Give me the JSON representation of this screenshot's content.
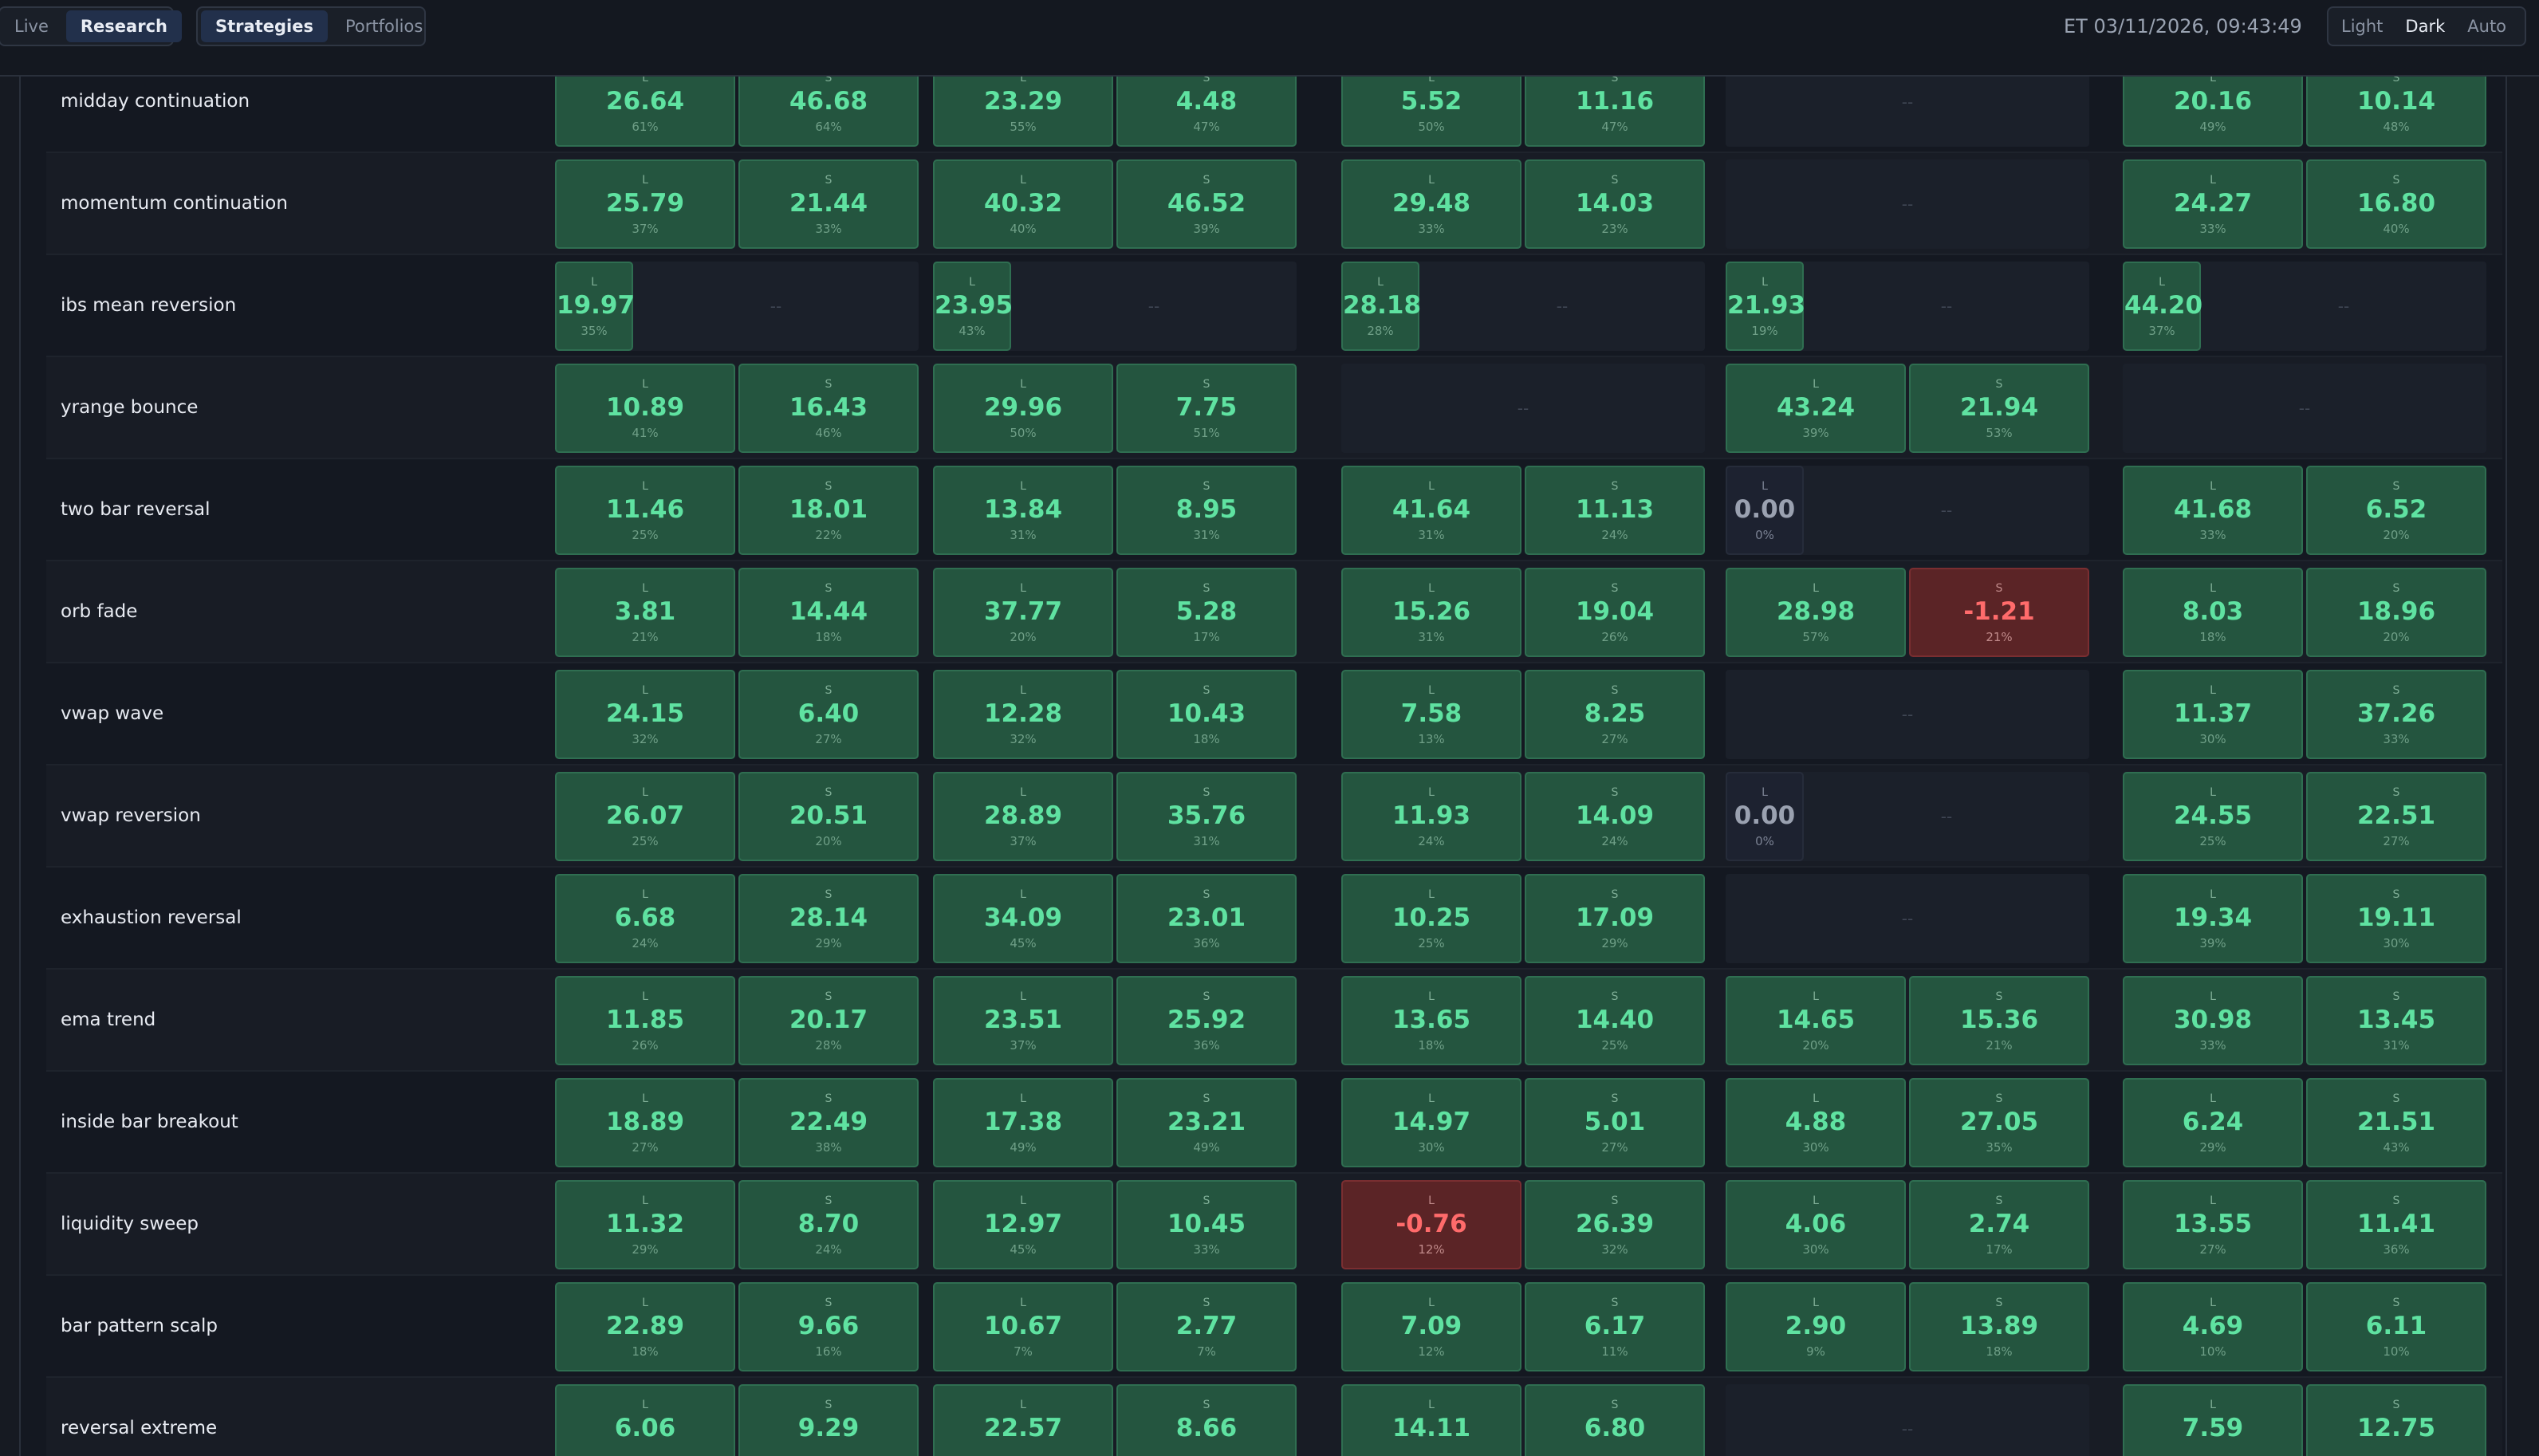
{
  "header": {
    "mode_tabs": [
      "Live",
      "Research"
    ],
    "mode_active": "Research",
    "view_tabs": [
      "Strategies",
      "Portfolios"
    ],
    "view_active": "Strategies",
    "clock": "ET 03/11/2026, 09:43:49",
    "theme_options": [
      "Light",
      "Dark",
      "Auto"
    ],
    "theme_active": "Dark"
  },
  "colors": {
    "positive_bg": "#24553f",
    "positive_text": "#5fe2a1",
    "negative_bg": "#5b2426",
    "negative_text": "#ff6b6b",
    "empty_bg": "#1b202a"
  },
  "empty_mark": "--",
  "rows": [
    {
      "name": "midday continuation",
      "groups": [
        {
          "cells": [
            {
              "side": "L",
              "value": "26.64",
              "pct": "61%"
            },
            {
              "side": "S",
              "value": "46.68",
              "pct": "64%"
            }
          ]
        },
        {
          "cells": [
            {
              "side": "L",
              "value": "23.29",
              "pct": "55%"
            },
            {
              "side": "S",
              "value": "4.48",
              "pct": "47%"
            }
          ]
        },
        {
          "cells": [
            {
              "side": "L",
              "value": "5.52",
              "pct": "50%"
            },
            {
              "side": "S",
              "value": "11.16",
              "pct": "47%"
            }
          ]
        },
        {
          "cells": []
        },
        {
          "cells": [
            {
              "side": "L",
              "value": "20.16",
              "pct": "49%"
            },
            {
              "side": "S",
              "value": "10.14",
              "pct": "48%"
            }
          ]
        }
      ]
    },
    {
      "name": "momentum continuation",
      "groups": [
        {
          "cells": [
            {
              "side": "L",
              "value": "25.79",
              "pct": "37%"
            },
            {
              "side": "S",
              "value": "21.44",
              "pct": "33%"
            }
          ]
        },
        {
          "cells": [
            {
              "side": "L",
              "value": "40.32",
              "pct": "40%"
            },
            {
              "side": "S",
              "value": "46.52",
              "pct": "39%"
            }
          ]
        },
        {
          "cells": [
            {
              "side": "L",
              "value": "29.48",
              "pct": "33%"
            },
            {
              "side": "S",
              "value": "14.03",
              "pct": "23%"
            }
          ]
        },
        {
          "cells": []
        },
        {
          "cells": [
            {
              "side": "L",
              "value": "24.27",
              "pct": "33%"
            },
            {
              "side": "S",
              "value": "16.80",
              "pct": "40%"
            }
          ]
        }
      ]
    },
    {
      "name": "ibs mean reversion",
      "groups": [
        {
          "cells": [
            {
              "side": "L",
              "value": "19.97",
              "pct": "35%",
              "narrow": true
            }
          ]
        },
        {
          "cells": [
            {
              "side": "L",
              "value": "23.95",
              "pct": "43%",
              "narrow": true
            }
          ]
        },
        {
          "cells": [
            {
              "side": "L",
              "value": "28.18",
              "pct": "28%",
              "narrow": true
            }
          ]
        },
        {
          "cells": [
            {
              "side": "L",
              "value": "21.93",
              "pct": "19%",
              "narrow": true
            }
          ]
        },
        {
          "cells": [
            {
              "side": "L",
              "value": "44.20",
              "pct": "37%",
              "narrow": true
            }
          ]
        }
      ]
    },
    {
      "name": "yrange bounce",
      "groups": [
        {
          "cells": [
            {
              "side": "L",
              "value": "10.89",
              "pct": "41%"
            },
            {
              "side": "S",
              "value": "16.43",
              "pct": "46%"
            }
          ]
        },
        {
          "cells": [
            {
              "side": "L",
              "value": "29.96",
              "pct": "50%"
            },
            {
              "side": "S",
              "value": "7.75",
              "pct": "51%"
            }
          ]
        },
        {
          "cells": []
        },
        {
          "cells": [
            {
              "side": "L",
              "value": "43.24",
              "pct": "39%"
            },
            {
              "side": "S",
              "value": "21.94",
              "pct": "53%"
            }
          ]
        },
        {
          "cells": []
        }
      ]
    },
    {
      "name": "two bar reversal",
      "groups": [
        {
          "cells": [
            {
              "side": "L",
              "value": "11.46",
              "pct": "25%"
            },
            {
              "side": "S",
              "value": "18.01",
              "pct": "22%"
            }
          ]
        },
        {
          "cells": [
            {
              "side": "L",
              "value": "13.84",
              "pct": "31%"
            },
            {
              "side": "S",
              "value": "8.95",
              "pct": "31%"
            }
          ]
        },
        {
          "cells": [
            {
              "side": "L",
              "value": "41.64",
              "pct": "31%"
            },
            {
              "side": "S",
              "value": "11.13",
              "pct": "24%"
            }
          ]
        },
        {
          "cells": [
            {
              "side": "L",
              "value": "0.00",
              "pct": "0%",
              "narrow": true
            }
          ]
        },
        {
          "cells": [
            {
              "side": "L",
              "value": "41.68",
              "pct": "33%"
            },
            {
              "side": "S",
              "value": "6.52",
              "pct": "20%"
            }
          ]
        }
      ]
    },
    {
      "name": "orb fade",
      "groups": [
        {
          "cells": [
            {
              "side": "L",
              "value": "3.81",
              "pct": "21%"
            },
            {
              "side": "S",
              "value": "14.44",
              "pct": "18%"
            }
          ]
        },
        {
          "cells": [
            {
              "side": "L",
              "value": "37.77",
              "pct": "20%"
            },
            {
              "side": "S",
              "value": "5.28",
              "pct": "17%"
            }
          ]
        },
        {
          "cells": [
            {
              "side": "L",
              "value": "15.26",
              "pct": "31%"
            },
            {
              "side": "S",
              "value": "19.04",
              "pct": "26%"
            }
          ]
        },
        {
          "cells": [
            {
              "side": "L",
              "value": "28.98",
              "pct": "57%"
            },
            {
              "side": "S",
              "value": "-1.21",
              "pct": "21%"
            }
          ]
        },
        {
          "cells": [
            {
              "side": "L",
              "value": "8.03",
              "pct": "18%"
            },
            {
              "side": "S",
              "value": "18.96",
              "pct": "20%"
            }
          ]
        }
      ]
    },
    {
      "name": "vwap wave",
      "groups": [
        {
          "cells": [
            {
              "side": "L",
              "value": "24.15",
              "pct": "32%"
            },
            {
              "side": "S",
              "value": "6.40",
              "pct": "27%"
            }
          ]
        },
        {
          "cells": [
            {
              "side": "L",
              "value": "12.28",
              "pct": "32%"
            },
            {
              "side": "S",
              "value": "10.43",
              "pct": "18%"
            }
          ]
        },
        {
          "cells": [
            {
              "side": "L",
              "value": "7.58",
              "pct": "13%"
            },
            {
              "side": "S",
              "value": "8.25",
              "pct": "27%"
            }
          ]
        },
        {
          "cells": []
        },
        {
          "cells": [
            {
              "side": "L",
              "value": "11.37",
              "pct": "30%"
            },
            {
              "side": "S",
              "value": "37.26",
              "pct": "33%"
            }
          ]
        }
      ]
    },
    {
      "name": "vwap reversion",
      "groups": [
        {
          "cells": [
            {
              "side": "L",
              "value": "26.07",
              "pct": "25%"
            },
            {
              "side": "S",
              "value": "20.51",
              "pct": "20%"
            }
          ]
        },
        {
          "cells": [
            {
              "side": "L",
              "value": "28.89",
              "pct": "37%"
            },
            {
              "side": "S",
              "value": "35.76",
              "pct": "31%"
            }
          ]
        },
        {
          "cells": [
            {
              "side": "L",
              "value": "11.93",
              "pct": "24%"
            },
            {
              "side": "S",
              "value": "14.09",
              "pct": "24%"
            }
          ]
        },
        {
          "cells": [
            {
              "side": "L",
              "value": "0.00",
              "pct": "0%",
              "narrow": true
            }
          ]
        },
        {
          "cells": [
            {
              "side": "L",
              "value": "24.55",
              "pct": "25%"
            },
            {
              "side": "S",
              "value": "22.51",
              "pct": "27%"
            }
          ]
        }
      ]
    },
    {
      "name": "exhaustion reversal",
      "groups": [
        {
          "cells": [
            {
              "side": "L",
              "value": "6.68",
              "pct": "24%"
            },
            {
              "side": "S",
              "value": "28.14",
              "pct": "29%"
            }
          ]
        },
        {
          "cells": [
            {
              "side": "L",
              "value": "34.09",
              "pct": "45%"
            },
            {
              "side": "S",
              "value": "23.01",
              "pct": "36%"
            }
          ]
        },
        {
          "cells": [
            {
              "side": "L",
              "value": "10.25",
              "pct": "25%"
            },
            {
              "side": "S",
              "value": "17.09",
              "pct": "29%"
            }
          ]
        },
        {
          "cells": []
        },
        {
          "cells": [
            {
              "side": "L",
              "value": "19.34",
              "pct": "39%"
            },
            {
              "side": "S",
              "value": "19.11",
              "pct": "30%"
            }
          ]
        }
      ]
    },
    {
      "name": "ema trend",
      "groups": [
        {
          "cells": [
            {
              "side": "L",
              "value": "11.85",
              "pct": "26%"
            },
            {
              "side": "S",
              "value": "20.17",
              "pct": "28%"
            }
          ]
        },
        {
          "cells": [
            {
              "side": "L",
              "value": "23.51",
              "pct": "37%"
            },
            {
              "side": "S",
              "value": "25.92",
              "pct": "36%"
            }
          ]
        },
        {
          "cells": [
            {
              "side": "L",
              "value": "13.65",
              "pct": "18%"
            },
            {
              "side": "S",
              "value": "14.40",
              "pct": "25%"
            }
          ]
        },
        {
          "cells": [
            {
              "side": "L",
              "value": "14.65",
              "pct": "20%"
            },
            {
              "side": "S",
              "value": "15.36",
              "pct": "21%"
            }
          ]
        },
        {
          "cells": [
            {
              "side": "L",
              "value": "30.98",
              "pct": "33%"
            },
            {
              "side": "S",
              "value": "13.45",
              "pct": "31%"
            }
          ]
        }
      ]
    },
    {
      "name": "inside bar breakout",
      "groups": [
        {
          "cells": [
            {
              "side": "L",
              "value": "18.89",
              "pct": "27%"
            },
            {
              "side": "S",
              "value": "22.49",
              "pct": "38%"
            }
          ]
        },
        {
          "cells": [
            {
              "side": "L",
              "value": "17.38",
              "pct": "49%"
            },
            {
              "side": "S",
              "value": "23.21",
              "pct": "49%"
            }
          ]
        },
        {
          "cells": [
            {
              "side": "L",
              "value": "14.97",
              "pct": "30%"
            },
            {
              "side": "S",
              "value": "5.01",
              "pct": "27%"
            }
          ]
        },
        {
          "cells": [
            {
              "side": "L",
              "value": "4.88",
              "pct": "30%"
            },
            {
              "side": "S",
              "value": "27.05",
              "pct": "35%"
            }
          ]
        },
        {
          "cells": [
            {
              "side": "L",
              "value": "6.24",
              "pct": "29%"
            },
            {
              "side": "S",
              "value": "21.51",
              "pct": "43%"
            }
          ]
        }
      ]
    },
    {
      "name": "liquidity sweep",
      "groups": [
        {
          "cells": [
            {
              "side": "L",
              "value": "11.32",
              "pct": "29%"
            },
            {
              "side": "S",
              "value": "8.70",
              "pct": "24%"
            }
          ]
        },
        {
          "cells": [
            {
              "side": "L",
              "value": "12.97",
              "pct": "45%"
            },
            {
              "side": "S",
              "value": "10.45",
              "pct": "33%"
            }
          ]
        },
        {
          "cells": [
            {
              "side": "L",
              "value": "-0.76",
              "pct": "12%"
            },
            {
              "side": "S",
              "value": "26.39",
              "pct": "32%"
            }
          ]
        },
        {
          "cells": [
            {
              "side": "L",
              "value": "4.06",
              "pct": "30%"
            },
            {
              "side": "S",
              "value": "2.74",
              "pct": "17%"
            }
          ]
        },
        {
          "cells": [
            {
              "side": "L",
              "value": "13.55",
              "pct": "27%"
            },
            {
              "side": "S",
              "value": "11.41",
              "pct": "36%"
            }
          ]
        }
      ]
    },
    {
      "name": "bar pattern scalp",
      "groups": [
        {
          "cells": [
            {
              "side": "L",
              "value": "22.89",
              "pct": "18%"
            },
            {
              "side": "S",
              "value": "9.66",
              "pct": "16%"
            }
          ]
        },
        {
          "cells": [
            {
              "side": "L",
              "value": "10.67",
              "pct": "7%"
            },
            {
              "side": "S",
              "value": "2.77",
              "pct": "7%"
            }
          ]
        },
        {
          "cells": [
            {
              "side": "L",
              "value": "7.09",
              "pct": "12%"
            },
            {
              "side": "S",
              "value": "6.17",
              "pct": "11%"
            }
          ]
        },
        {
          "cells": [
            {
              "side": "L",
              "value": "2.90",
              "pct": "9%"
            },
            {
              "side": "S",
              "value": "13.89",
              "pct": "18%"
            }
          ]
        },
        {
          "cells": [
            {
              "side": "L",
              "value": "4.69",
              "pct": "10%"
            },
            {
              "side": "S",
              "value": "6.11",
              "pct": "10%"
            }
          ]
        }
      ]
    },
    {
      "name": "reversal extreme",
      "groups": [
        {
          "cells": [
            {
              "side": "L",
              "value": "6.06",
              "pct": ""
            },
            {
              "side": "S",
              "value": "9.29",
              "pct": ""
            }
          ]
        },
        {
          "cells": [
            {
              "side": "L",
              "value": "22.57",
              "pct": ""
            },
            {
              "side": "S",
              "value": "8.66",
              "pct": ""
            }
          ]
        },
        {
          "cells": [
            {
              "side": "L",
              "value": "14.11",
              "pct": ""
            },
            {
              "side": "S",
              "value": "6.80",
              "pct": ""
            }
          ]
        },
        {
          "cells": []
        },
        {
          "cells": [
            {
              "side": "L",
              "value": "7.59",
              "pct": ""
            },
            {
              "side": "S",
              "value": "12.75",
              "pct": ""
            }
          ]
        }
      ]
    }
  ]
}
